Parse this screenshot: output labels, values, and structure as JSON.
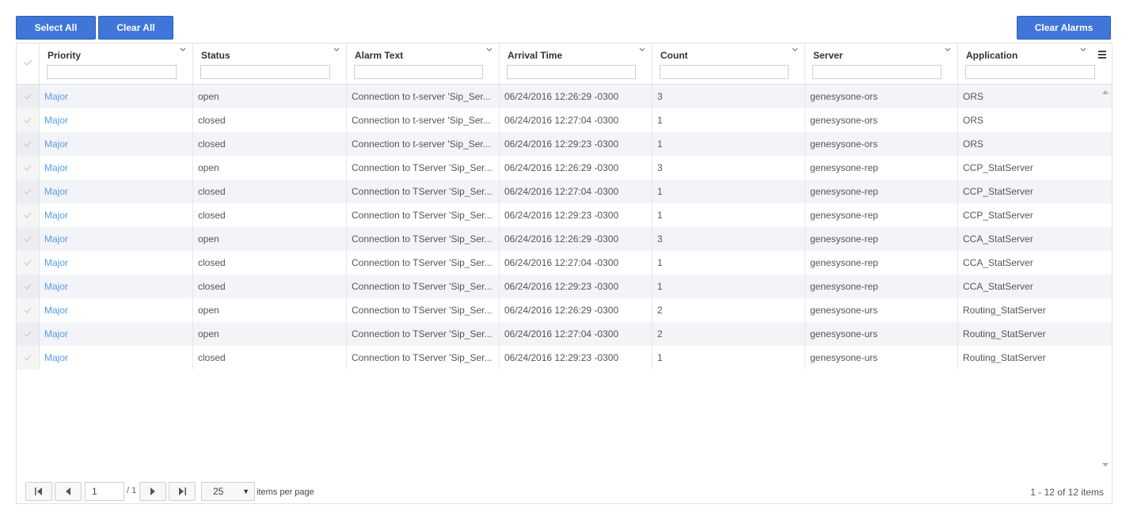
{
  "toolbar": {
    "select_all": "Select All",
    "clear_all": "Clear All",
    "clear_alarms": "Clear Alarms"
  },
  "columns": [
    {
      "key": "priority",
      "label": "Priority"
    },
    {
      "key": "status",
      "label": "Status"
    },
    {
      "key": "alarm_text",
      "label": "Alarm Text"
    },
    {
      "key": "arrival_time",
      "label": "Arrival Time"
    },
    {
      "key": "count",
      "label": "Count"
    },
    {
      "key": "server",
      "label": "Server"
    },
    {
      "key": "application",
      "label": "Application"
    }
  ],
  "rows": [
    {
      "priority": "Major",
      "status": "open",
      "alarm_text": "Connection to t-server 'Sip_Ser...",
      "arrival_time": "06/24/2016 12:26:29 -0300",
      "count": "3",
      "server": "genesysone-ors",
      "application": "ORS"
    },
    {
      "priority": "Major",
      "status": "closed",
      "alarm_text": "Connection to t-server 'Sip_Ser...",
      "arrival_time": "06/24/2016 12:27:04 -0300",
      "count": "1",
      "server": "genesysone-ors",
      "application": "ORS"
    },
    {
      "priority": "Major",
      "status": "closed",
      "alarm_text": "Connection to t-server 'Sip_Ser...",
      "arrival_time": "06/24/2016 12:29:23 -0300",
      "count": "1",
      "server": "genesysone-ors",
      "application": "ORS"
    },
    {
      "priority": "Major",
      "status": "open",
      "alarm_text": "Connection to TServer 'Sip_Ser...",
      "arrival_time": "06/24/2016 12:26:29 -0300",
      "count": "3",
      "server": "genesysone-rep",
      "application": "CCP_StatServer"
    },
    {
      "priority": "Major",
      "status": "closed",
      "alarm_text": "Connection to TServer 'Sip_Ser...",
      "arrival_time": "06/24/2016 12:27:04 -0300",
      "count": "1",
      "server": "genesysone-rep",
      "application": "CCP_StatServer"
    },
    {
      "priority": "Major",
      "status": "closed",
      "alarm_text": "Connection to TServer 'Sip_Ser...",
      "arrival_time": "06/24/2016 12:29:23 -0300",
      "count": "1",
      "server": "genesysone-rep",
      "application": "CCP_StatServer"
    },
    {
      "priority": "Major",
      "status": "open",
      "alarm_text": "Connection to TServer 'Sip_Ser...",
      "arrival_time": "06/24/2016 12:26:29 -0300",
      "count": "3",
      "server": "genesysone-rep",
      "application": "CCA_StatServer"
    },
    {
      "priority": "Major",
      "status": "closed",
      "alarm_text": "Connection to TServer 'Sip_Ser...",
      "arrival_time": "06/24/2016 12:27:04 -0300",
      "count": "1",
      "server": "genesysone-rep",
      "application": "CCA_StatServer"
    },
    {
      "priority": "Major",
      "status": "closed",
      "alarm_text": "Connection to TServer 'Sip_Ser...",
      "arrival_time": "06/24/2016 12:29:23 -0300",
      "count": "1",
      "server": "genesysone-rep",
      "application": "CCA_StatServer"
    },
    {
      "priority": "Major",
      "status": "open",
      "alarm_text": "Connection to TServer 'Sip_Ser...",
      "arrival_time": "06/24/2016 12:26:29 -0300",
      "count": "2",
      "server": "genesysone-urs",
      "application": "Routing_StatServer"
    },
    {
      "priority": "Major",
      "status": "open",
      "alarm_text": "Connection to TServer 'Sip_Ser...",
      "arrival_time": "06/24/2016 12:27:04 -0300",
      "count": "2",
      "server": "genesysone-urs",
      "application": "Routing_StatServer"
    },
    {
      "priority": "Major",
      "status": "closed",
      "alarm_text": "Connection to TServer 'Sip_Ser...",
      "arrival_time": "06/24/2016 12:29:23 -0300",
      "count": "1",
      "server": "genesysone-urs",
      "application": "Routing_StatServer"
    }
  ],
  "pager": {
    "current_page": "1",
    "total_pages": "/ 1",
    "page_size": "25",
    "items_per_page_label": "items per page",
    "info": "1 - 12 of 12 items"
  },
  "colors": {
    "button_bg": "#3f76d8",
    "priority_link": "#5a9be8",
    "row_alt": "#f2f4f7"
  },
  "icons": {
    "row_check": "checkmark-icon",
    "column_menu": "chevron-down-icon",
    "grid_menu": "hamburger-icon",
    "pager_first": "first-page-icon",
    "pager_prev": "prev-page-icon",
    "pager_next": "next-page-icon",
    "pager_last": "last-page-icon"
  }
}
